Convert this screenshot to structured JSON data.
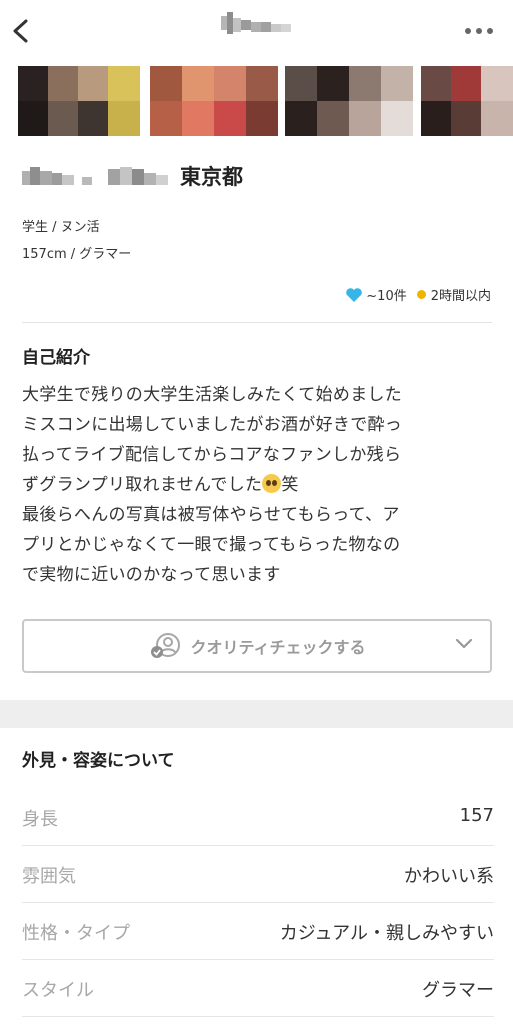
{
  "header": {
    "back_icon": "chevron-left-icon",
    "more_icon": "more-dots-icon"
  },
  "profile": {
    "prefecture": "東京都",
    "occupation_line": "学生 / ヌン活",
    "body_line": "157cm / グラマー",
    "likes": "~10件",
    "last_login": "2時間以内",
    "heart_color": "#35b6e6",
    "login_dot_color": "#f0b400"
  },
  "intro": {
    "title": "自己紹介",
    "text_before_emoji": "大学生で残りの大学生活楽しみたくて始めました\nミスコンに出場していましたがお酒が好きで酔っ\n払ってライブ配信してからコアなファンしか残ら\nずグランプリ取れませんでした",
    "text_after_emoji": "笑\n最後らへんの写真は被写体やらせてもらって、ア\nプリとかじゃなくて一眼で撮ってもらった物なの\nで実物に近いのかなって思います"
  },
  "quality_check": {
    "label": "クオリティチェックする"
  },
  "appearance": {
    "title": "外見・容姿について",
    "rows": [
      {
        "label": "身長",
        "value": "157"
      },
      {
        "label": "雰囲気",
        "value": "かわいい系"
      },
      {
        "label": "性格・タイプ",
        "value": "カジュアル・親しみやすい"
      },
      {
        "label": "スタイル",
        "value": "グラマー"
      }
    ]
  }
}
